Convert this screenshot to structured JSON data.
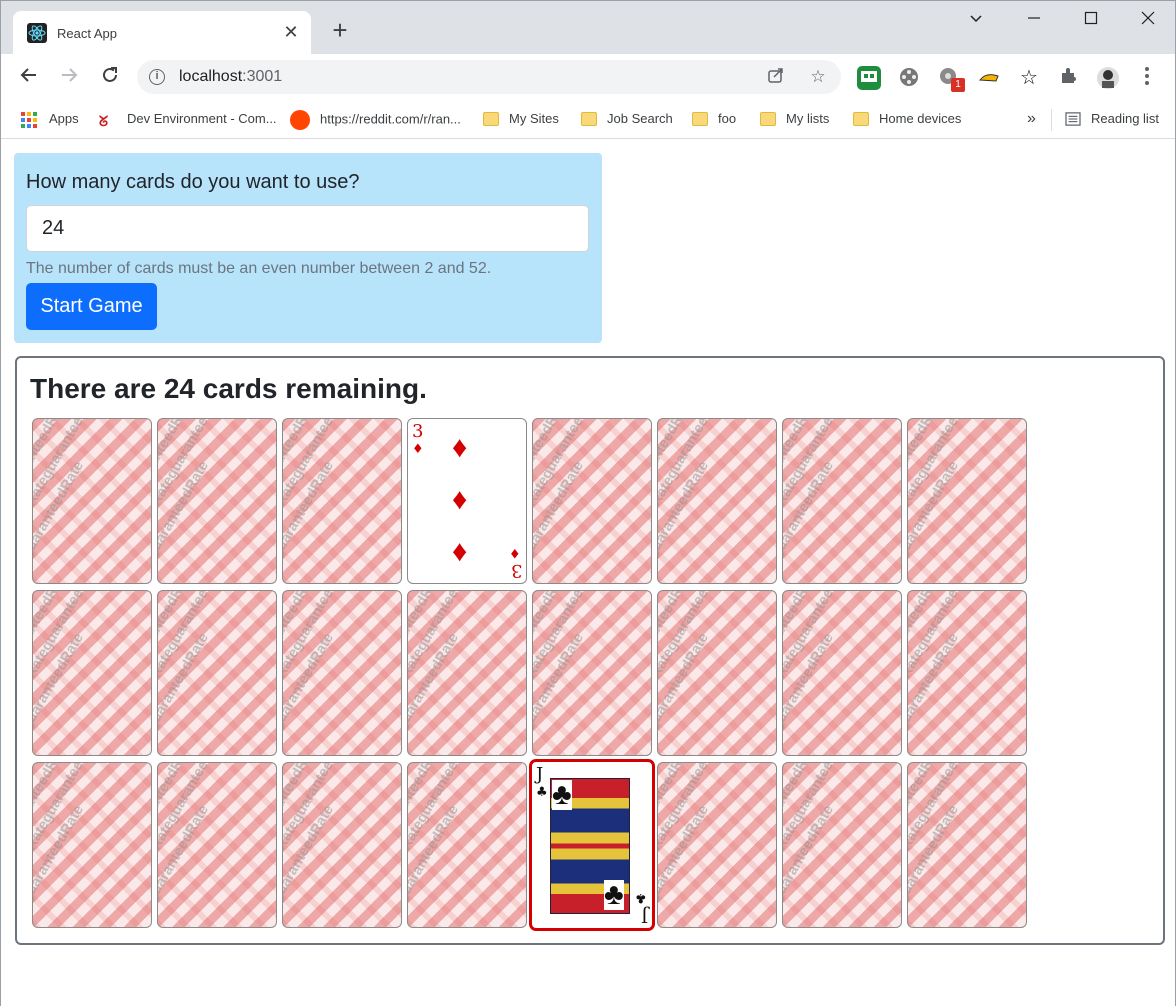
{
  "browser": {
    "tab_title": "React App",
    "tab_close": "✕",
    "new_tab": "+",
    "url_host": "localhost",
    "url_port": ":3001",
    "extension_badge": "1",
    "bookmarks": [
      {
        "label": "Apps",
        "icon": "apps-grid-icon"
      },
      {
        "label": "Dev Environment - Com...",
        "icon": "dev-environment-icon"
      },
      {
        "label": "https://reddit.com/r/ran...",
        "icon": "reddit-icon"
      },
      {
        "label": "My Sites",
        "icon": "folder-icon"
      },
      {
        "label": "Job Search",
        "icon": "folder-icon"
      },
      {
        "label": "foo",
        "icon": "folder-icon"
      },
      {
        "label": "My lists",
        "icon": "folder-icon"
      },
      {
        "label": "Home devices",
        "icon": "folder-icon"
      }
    ],
    "overflow": "»",
    "reading_list": "Reading list"
  },
  "setup": {
    "question": "How many cards do you want to use?",
    "card_count_value": "24",
    "hint": "The number of cards must be an even number between 2 and 52.",
    "start_label": "Start Game"
  },
  "board": {
    "remaining_text": "There are 24 cards remaining.",
    "back_brand_text": "guaranteedRate",
    "cards": [
      {
        "state": "back"
      },
      {
        "state": "back"
      },
      {
        "state": "back"
      },
      {
        "state": "face",
        "rank": "3",
        "suit": "♦",
        "color": "red"
      },
      {
        "state": "back"
      },
      {
        "state": "back"
      },
      {
        "state": "back"
      },
      {
        "state": "back"
      },
      {
        "state": "back"
      },
      {
        "state": "back"
      },
      {
        "state": "back"
      },
      {
        "state": "back"
      },
      {
        "state": "back"
      },
      {
        "state": "back"
      },
      {
        "state": "back"
      },
      {
        "state": "back"
      },
      {
        "state": "back"
      },
      {
        "state": "back"
      },
      {
        "state": "back"
      },
      {
        "state": "back"
      },
      {
        "state": "face",
        "rank": "J",
        "suit": "♣",
        "color": "black",
        "selected": true
      },
      {
        "state": "back"
      },
      {
        "state": "back"
      },
      {
        "state": "back"
      }
    ]
  },
  "colors": {
    "setup_bg": "#b7e3fb",
    "button": "#0d6efd",
    "card_back_accent": "#e57373",
    "selected_border": "#d40000"
  }
}
